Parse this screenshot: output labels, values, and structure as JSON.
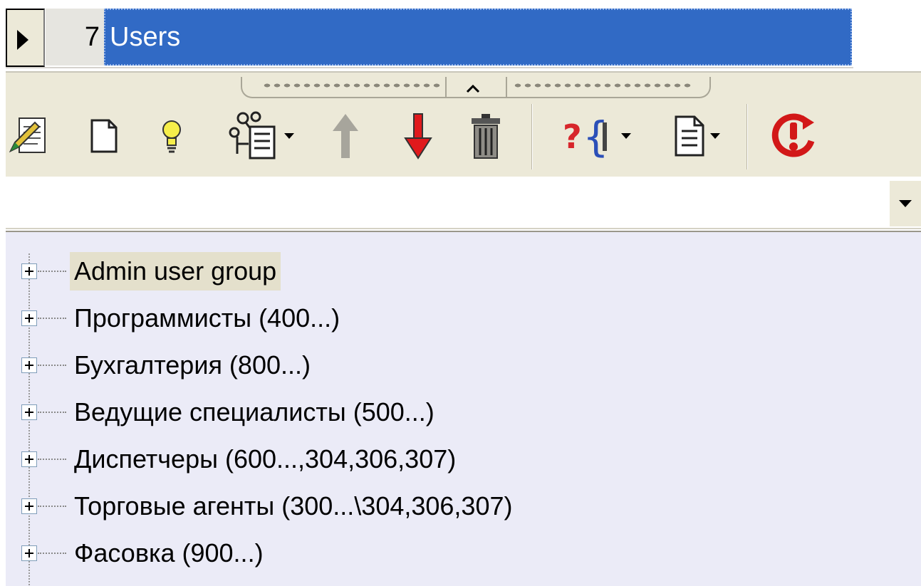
{
  "grid": {
    "row_number": "7",
    "row_name": "Users"
  },
  "toolbar": {
    "buttons": [
      {
        "icon": "edit-document-icon"
      },
      {
        "icon": "new-document-icon"
      },
      {
        "icon": "lightbulb-icon"
      },
      {
        "icon": "tree-structure-icon",
        "dropdown": true
      },
      {
        "icon": "move-up-arrow-icon",
        "disabled": true
      },
      {
        "icon": "move-down-arrow-icon"
      },
      {
        "icon": "trash-icon"
      },
      {
        "icon": "query-braces-icon",
        "dropdown": true
      },
      {
        "icon": "report-document-icon",
        "dropdown": true
      },
      {
        "icon": "refresh-alert-icon"
      }
    ]
  },
  "combo": {
    "value": ""
  },
  "tree": {
    "items": [
      {
        "label": "Admin user group",
        "selected": true
      },
      {
        "label": "Программисты (400...)"
      },
      {
        "label": "Бухгалтерия (800...)"
      },
      {
        "label": "Ведущие специалисты (500...)"
      },
      {
        "label": "Диспетчеры (600...,304,306,307)"
      },
      {
        "label": "Торговые агенты (300...\\304,306,307)"
      },
      {
        "label": "Фасовка (900...)"
      }
    ]
  },
  "colors": {
    "selection_blue": "#316ac5",
    "toolbar_bg": "#ece9d8",
    "tree_bg": "#ebebf7",
    "arrow_red": "#e0191c",
    "refresh_red": "#d21818"
  }
}
